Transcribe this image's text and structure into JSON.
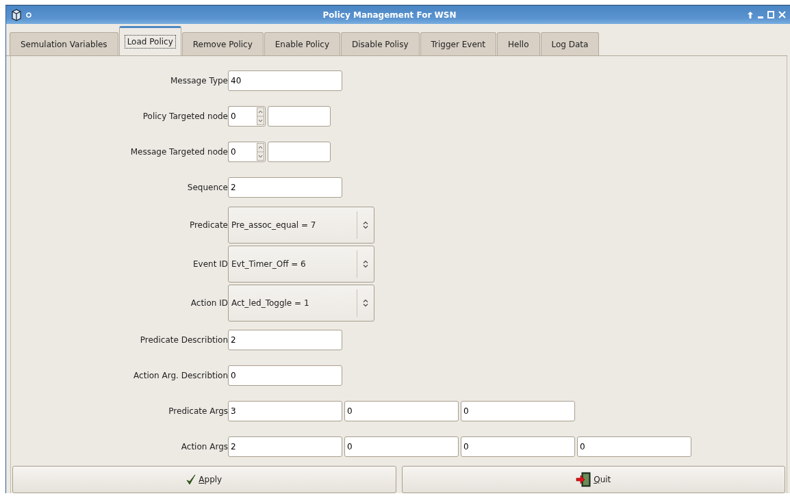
{
  "window": {
    "title": "Policy Management For WSN"
  },
  "tabs": [
    {
      "label": "Semulation Variables",
      "selected": false
    },
    {
      "label": "Load Policy",
      "selected": true
    },
    {
      "label": "Remove Policy",
      "selected": false
    },
    {
      "label": "Enable Policy",
      "selected": false
    },
    {
      "label": "Disable Polisy",
      "selected": false
    },
    {
      "label": "Trigger Event",
      "selected": false
    },
    {
      "label": "Hello",
      "selected": false
    },
    {
      "label": "Log Data",
      "selected": false
    }
  ],
  "form": {
    "rows": [
      {
        "kind": "text",
        "label": "Message Type",
        "values": [
          "40"
        ]
      },
      {
        "kind": "spin",
        "label": "Policy Targeted node",
        "values": [
          "0"
        ]
      },
      {
        "kind": "spin",
        "label": "Message Targeted node",
        "values": [
          "0"
        ]
      },
      {
        "kind": "text",
        "label": "Sequence",
        "values": [
          "2"
        ]
      },
      {
        "kind": "combo",
        "label": "Predicate",
        "values": [
          "Pre_assoc_equal = 7"
        ]
      },
      {
        "kind": "combo",
        "label": "Event ID",
        "values": [
          "Evt_Timer_Off = 6"
        ]
      },
      {
        "kind": "combo",
        "label": "Action ID",
        "values": [
          "Act_led_Toggle = 1"
        ]
      },
      {
        "kind": "text",
        "label": "Predicate Describtion",
        "values": [
          "2"
        ]
      },
      {
        "kind": "text",
        "label": "Action Arg. Describtion",
        "values": [
          "0"
        ]
      },
      {
        "kind": "text",
        "label": "Predicate Args",
        "values": [
          "3",
          "0",
          "0"
        ]
      },
      {
        "kind": "text",
        "label": "Action Args",
        "values": [
          "2",
          "0",
          "0",
          "0"
        ]
      }
    ]
  },
  "buttons": [
    {
      "kind": "apply",
      "label": "Apply"
    },
    {
      "kind": "quit",
      "label": "Quit"
    }
  ]
}
